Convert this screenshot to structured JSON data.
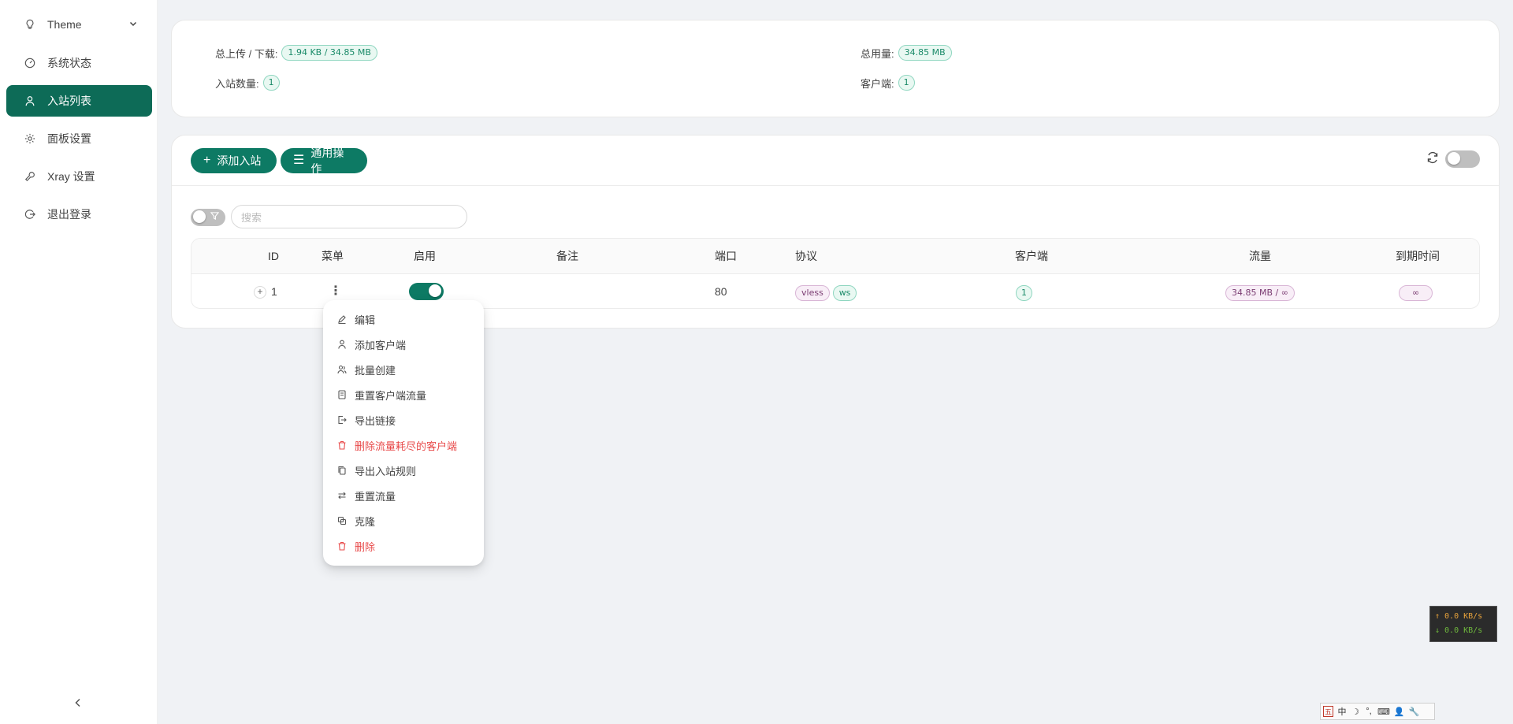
{
  "sidebar": {
    "items": [
      {
        "label": "Theme",
        "icon": "bulb-icon"
      },
      {
        "label": "系统状态",
        "icon": "dashboard-icon"
      },
      {
        "label": "入站列表",
        "icon": "user-icon",
        "active": true
      },
      {
        "label": "面板设置",
        "icon": "gear-icon"
      },
      {
        "label": "Xray 设置",
        "icon": "tool-icon"
      },
      {
        "label": "退出登录",
        "icon": "logout-icon"
      }
    ]
  },
  "stats": {
    "upload_download_label": "总上传 / 下载:",
    "upload_download_value": "1.94 KB / 34.85 MB",
    "total_usage_label": "总用量:",
    "total_usage_value": "34.85 MB",
    "inbound_count_label": "入站数量:",
    "inbound_count_value": "1",
    "clients_label": "客户端:",
    "clients_value": "1"
  },
  "toolbar": {
    "add_inbound": "添加入站",
    "general_actions": "通用操作"
  },
  "search": {
    "placeholder": "搜索"
  },
  "table": {
    "headers": {
      "id": "ID",
      "menu": "菜单",
      "enable": "启用",
      "remark": "备注",
      "port": "端口",
      "protocol": "协议",
      "clients": "客户端",
      "traffic": "流量",
      "expiry": "到期时间"
    },
    "rows": [
      {
        "id": "1",
        "enabled": true,
        "remark": "",
        "port": "80",
        "protocol": "vless",
        "transport": "ws",
        "clients": "1",
        "traffic": "34.85 MB / ∞",
        "expiry": "∞"
      }
    ]
  },
  "menu": {
    "items": [
      {
        "label": "编辑",
        "icon": "edit-icon"
      },
      {
        "label": "添加客户端",
        "icon": "user-add-icon"
      },
      {
        "label": "批量创建",
        "icon": "users-icon"
      },
      {
        "label": "重置客户端流量",
        "icon": "file-reset-icon"
      },
      {
        "label": "导出链接",
        "icon": "export-icon"
      },
      {
        "label": "删除流量耗尽的客户端",
        "icon": "trash-icon",
        "danger": true
      },
      {
        "label": "导出入站规则",
        "icon": "copy-icon"
      },
      {
        "label": "重置流量",
        "icon": "swap-icon"
      },
      {
        "label": "克隆",
        "icon": "clone-icon"
      },
      {
        "label": "删除",
        "icon": "delete-icon",
        "danger": true
      }
    ]
  },
  "speed": {
    "up": "↑ 0.0 KB/s",
    "down": "↓ 0.0 KB/s"
  },
  "ime": {
    "mode": "中"
  },
  "colors": {
    "accent": "#0d7a64",
    "sidebar_active": "#0d6b57",
    "danger": "#e84a4a"
  }
}
